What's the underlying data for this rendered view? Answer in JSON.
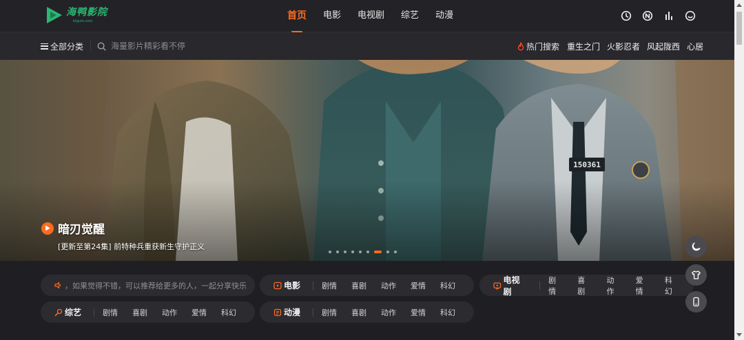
{
  "site": {
    "logo_name": "海鸭影院",
    "logo_sub": "ktgum.com",
    "accent": "#ff6a1f",
    "brand_green": "#2bb673"
  },
  "nav": {
    "items": [
      {
        "label": "首页",
        "active": true
      },
      {
        "label": "电影",
        "active": false
      },
      {
        "label": "电视剧",
        "active": false
      },
      {
        "label": "综艺",
        "active": false
      },
      {
        "label": "动漫",
        "active": false
      }
    ]
  },
  "top_icons": [
    "clock-icon",
    "n-badge-icon",
    "bar-chart-icon",
    "smile-icon"
  ],
  "subbar": {
    "all_categories": "全部分类",
    "search_placeholder": "海量影片精彩看不停",
    "hot_label": "热门搜索",
    "hot_links": [
      "重生之门",
      "火影忍者",
      "风起陇西",
      "心居"
    ]
  },
  "banner": {
    "title": "暗刃觉醒",
    "subtitle": "[更新至第24集] 前特种兵重获新生守护正义",
    "badge_number": "150361",
    "slide_count": 9,
    "active_slide": 7
  },
  "notice": {
    "text": "，如果觉得不错，可以推荐给更多的人，一起分享快乐"
  },
  "category_pills": [
    {
      "title": "电影",
      "icon": "film-icon",
      "links": [
        "剧情",
        "喜剧",
        "动作",
        "爱情",
        "科幻"
      ]
    },
    {
      "title": "电视剧",
      "icon": "tv-icon",
      "links": [
        "剧情",
        "喜剧",
        "动作",
        "爱情",
        "科幻"
      ]
    },
    {
      "title": "综艺",
      "icon": "mic-icon",
      "links": [
        "剧情",
        "喜剧",
        "动作",
        "爱情",
        "科幻"
      ]
    },
    {
      "title": "动漫",
      "icon": "anime-icon",
      "links": [
        "剧情",
        "喜剧",
        "动作",
        "爱情",
        "科幻"
      ]
    }
  ],
  "floating_buttons": [
    "moon-icon",
    "shirt-icon",
    "mobile-icon"
  ]
}
